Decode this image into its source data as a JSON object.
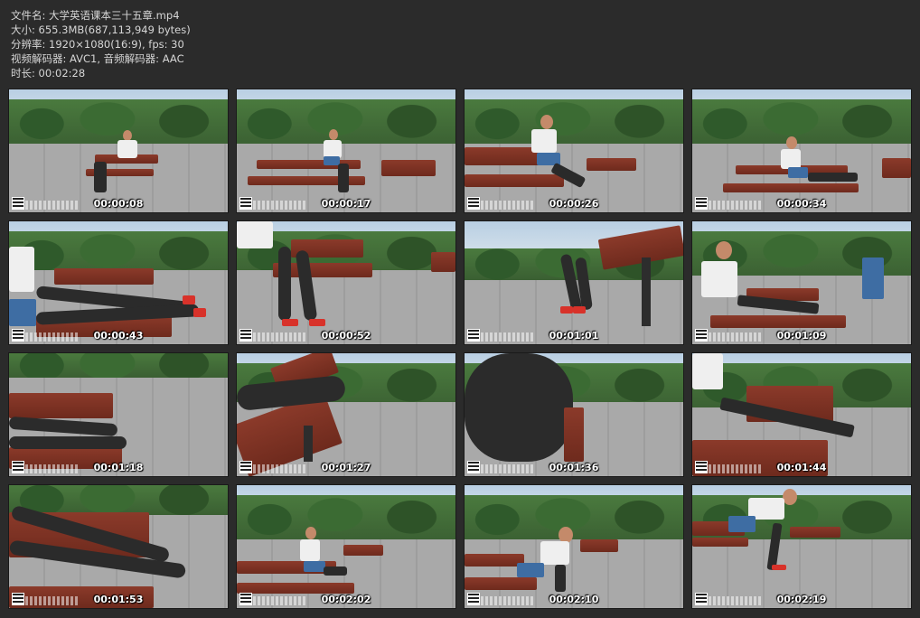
{
  "file_info": {
    "filename_label": "文件名",
    "filename": "大学英语课本三十五章.mp4",
    "size_label": "大小",
    "size": "655.3MB(687,113,949 bytes)",
    "resolution_label": "分辨率",
    "resolution": "1920×1080(16:9), fps: 30",
    "codec_label": "视频解码器",
    "codec": "AVC1, 音频解码器: AAC",
    "duration_label": "时长",
    "duration": "00:02:28"
  },
  "thumbnails": [
    {
      "time": "00:00:08"
    },
    {
      "time": "00:00:17"
    },
    {
      "time": "00:00:26"
    },
    {
      "time": "00:00:34"
    },
    {
      "time": "00:00:43"
    },
    {
      "time": "00:00:52"
    },
    {
      "time": "00:01:01"
    },
    {
      "time": "00:01:09"
    },
    {
      "time": "00:01:18"
    },
    {
      "time": "00:01:27"
    },
    {
      "time": "00:01:36"
    },
    {
      "time": "00:01:44"
    },
    {
      "time": "00:01:53"
    },
    {
      "time": "00:02:02"
    },
    {
      "time": "00:02:10"
    },
    {
      "time": "00:02:19"
    }
  ]
}
